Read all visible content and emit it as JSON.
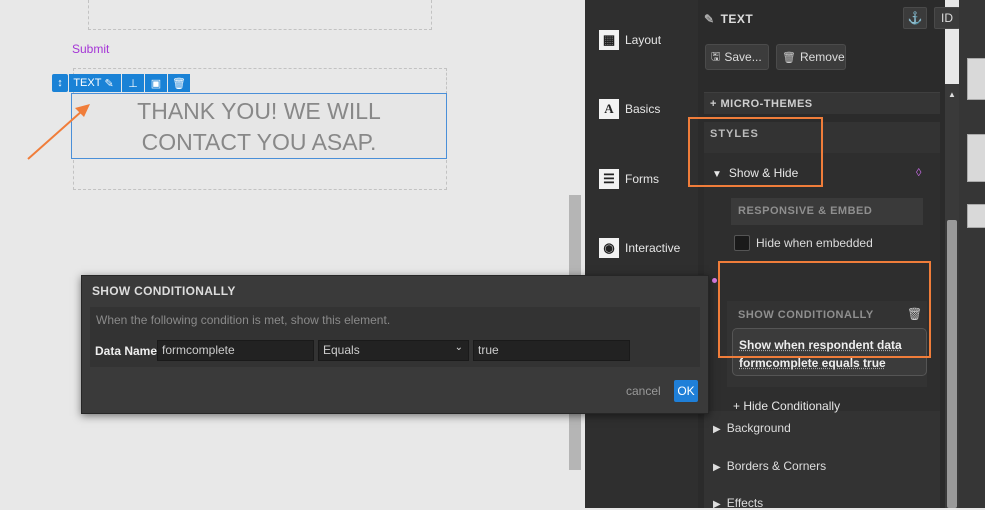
{
  "canvas": {
    "submit_link": "Submit",
    "toolbar": {
      "text_label": "TEXT"
    },
    "thanks_text_line1": "THANK YOU! WE WILL",
    "thanks_text_line2": "CONTACT YOU ASAP."
  },
  "dialog": {
    "title": "SHOW CONDITIONALLY",
    "description": "When the following condition is met, show this element.",
    "data_name_label": "Data Name",
    "data_name_value": "formcomplete",
    "operator_value": "Equals",
    "compare_value": "true",
    "cancel_label": "cancel",
    "ok_label": "OK"
  },
  "side_panel": {
    "items": [
      {
        "label": "Layout",
        "icon": "layout-icon"
      },
      {
        "label": "Basics",
        "icon": "basics-icon"
      },
      {
        "label": "Forms",
        "icon": "forms-icon"
      },
      {
        "label": "Interactive",
        "icon": "interactive-icon"
      }
    ]
  },
  "props": {
    "title": "TEXT",
    "id_label": "ID",
    "save_label": "Save...",
    "remove_label": "Remove",
    "micro_themes": "+ MICRO-THEMES",
    "styles_label": "STYLES",
    "show_hide_label": "Show & Hide",
    "responsive_embed_label": "RESPONSIVE & EMBED",
    "hide_when_embedded_label": "Hide when embedded",
    "show_conditionally_label": "SHOW CONDITIONALLY",
    "condition_summary_line1": "Show when respondent data",
    "condition_summary_line2": "formcomplete equals true",
    "hide_conditionally_label": "+ Hide Conditionally",
    "background_label": "Background",
    "borders_label": "Borders & Corners",
    "effects_label": "Effects"
  },
  "colors": {
    "accent_blue": "#1a82d6",
    "highlight_orange": "#f07d3a",
    "link_purple": "#a435d6"
  }
}
